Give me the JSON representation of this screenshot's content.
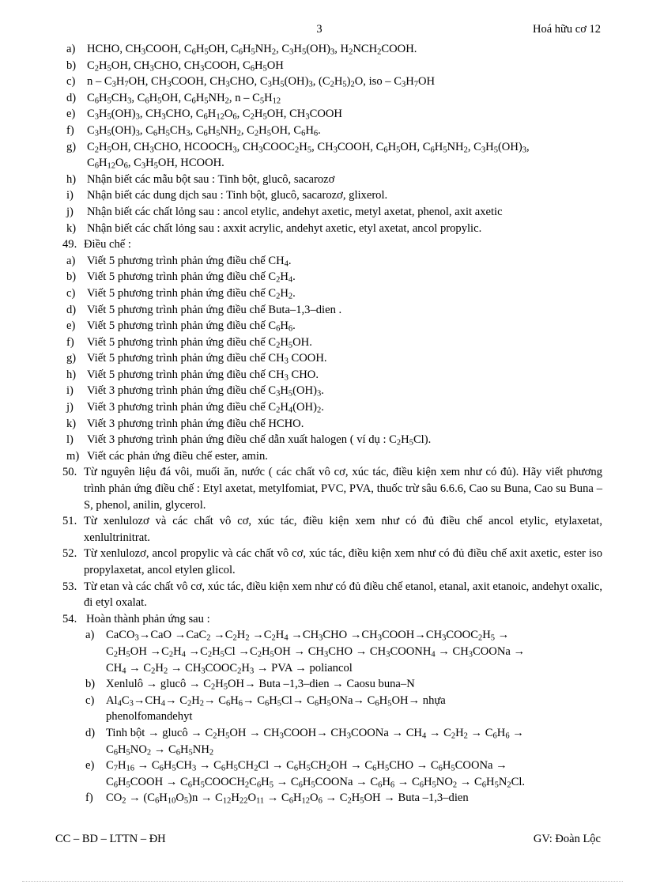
{
  "header": {
    "page_number": "3",
    "document_title": "Hoá hữu cơ 12"
  },
  "footer": {
    "left": "CC – BD – LTTN – ĐH",
    "right": "GV: Đoàn Lộc"
  },
  "exercise_48_items": [
    {
      "marker": "a)",
      "text": "HCHO, CH3COOH, C6H5OH,  C6H5NH2, C3H5(OH)3, H2NCH2COOH."
    },
    {
      "marker": "b)",
      "text": "C2H5OH, CH3CHO, CH3COOH, C6H5OH"
    },
    {
      "marker": "c)",
      "text": " n – C3H7OH, CH3COOH, CH3CHO, C3H5(OH)3, (C2H5)2O, iso – C3H7OH"
    },
    {
      "marker": "d)",
      "text": "C6H5CH3, C6H5OH,  C6H5NH2, n – C5H12"
    },
    {
      "marker": "e)",
      "text": "C3H5(OH)3, CH3CHO, C6H12O6, C2H5OH, CH3COOH"
    },
    {
      "marker": "f)",
      "text": "C3H5(OH)3, C6H5CH3, C6H5NH2, C2H5OH, C6H6."
    },
    {
      "marker": "g)",
      "line1": "C2H5OH, CH3CHO, HCOOCH3, CH3COOC2H5, CH3COOH, C6H5OH, C6H5NH2, C3H5(OH)3,",
      "line2": "C6H12O6, C3H5OH, HCOOH."
    },
    {
      "marker": "h)",
      "text": "Nhận biết các mẫu bột sau : Tinh bột, glucô, sacarozơ"
    },
    {
      "marker": "i)",
      "text": "Nhận biết các dung dịch sau : Tinh bột, glucô, sacarozơ, glixerol."
    },
    {
      "marker": "j)",
      "text": "Nhận biết các chất lỏng sau : ancol etylic, andehyt axetic, metyl axetat, phenol, axit axetic"
    },
    {
      "marker": "k)",
      "text": "Nhận biết các chất lỏng sau : axxit acrylic, andehyt axetic, etyl axetat, ancol propylic."
    }
  ],
  "exercise_49": {
    "number": "49.",
    "title": "Điều chế :",
    "items": [
      {
        "marker": "a)",
        "text": "Viết 5 phương trình phản ứng điều chế CH4."
      },
      {
        "marker": "b)",
        "text": "Viết 5 phương trình phản ứng điều chế C2H4."
      },
      {
        "marker": "c)",
        "text": "Viết 5 phương trình phản ứng điều chế C2H2."
      },
      {
        "marker": "d)",
        "text": "Viết 5 phương trình phản ứng điều chế Buta–1,3–dien ."
      },
      {
        "marker": "e)",
        "text": "Viết 5 phương trình phản ứng điều chế C6H6."
      },
      {
        "marker": "f)",
        "text": "Viết 5 phương trình phản ứng điều chế C2H5OH."
      },
      {
        "marker": "g)",
        "text": "Viết 5 phương trình phản ứng điều chế CH3 COOH."
      },
      {
        "marker": "h)",
        "text": "Viết 5 phương trình phản ứng điều chế CH3 CHO."
      },
      {
        "marker": "i)",
        "text": "Viết 3 phương trình phản ứng điều chế C3H5(OH)3."
      },
      {
        "marker": "j)",
        "text": "Viết 3 phương trình phản ứng điều chế C2H4(OH)2."
      },
      {
        "marker": "k)",
        "text": "Viết 3 phương trình phản ứng điều chế HCHO."
      },
      {
        "marker": "l)",
        "text": "Viết 3 phương trình phản ứng điều chế dẫn xuất halogen ( ví dụ : C2H5Cl)."
      },
      {
        "marker": "m)",
        "text": "Viết các phản ứng điều chế ester, amin."
      }
    ]
  },
  "exercise_50": {
    "number": "50.",
    "text": "Từ nguyên liệu đá vôi, muối ăn, nước ( các chất vô cơ, xúc tác, điều kiện xem như có đủ). Hãy viết phương trình phản ứng điều chế : Etyl axetat, metylfomiat, PVC, PVA, thuốc trừ sâu 6.6.6, Cao su Buna, Cao su Buna – S, phenol, anilin, glycerol."
  },
  "exercise_51": {
    "number": "51.",
    "text": "Từ xenlulozơ và các chất vô cơ, xúc tác, điều kiện xem như có đủ điều chế ancol etylic, etylaxetat, xenlultrinitrat."
  },
  "exercise_52": {
    "number": "52.",
    "text": "Từ xenlulozơ, ancol propylic và các chất vô cơ, xúc tác, điều kiện xem như có đủ điều chế axit axetic, ester iso propylaxetat, ancol etylen glicol."
  },
  "exercise_53": {
    "number": "53.",
    "text": "Từ etan và các chất vô cơ, xúc tác, điều kiện xem như có đủ điều chế etanol, etanal, axit etanoic, andehyt oxalic, đi etyl oxalat."
  },
  "exercise_54": {
    "number": "54.",
    "title": "Hoàn thành phản ứng sau :",
    "items": [
      {
        "marker": "a)",
        "line1": "CaCO3→CaO  →CaC2  →C2H2  →C2H4  →CH3CHO   →CH3COOH→CH3COOC2H5  →",
        "line2": "C2H5OH →C2H4 →C2H5Cl →C2H5OH → CH3CHO → CH3COONH4 → CH3COONa →",
        "line3": "CH4 → C2H2 → CH3COOC2H3 → PVA → poliancol"
      },
      {
        "marker": "b)",
        "line1": "Xenlulô → glucô → C2H5OH→ Buta –1,3–dien → Caosu buna–N"
      },
      {
        "marker": "c)",
        "line1": "Al4C3→CH4→    C2H2→    C6H6→    C6H5Cl→    C6H5ONa→    C6H5OH→    nhựa",
        "line2": "phenolfomandehyt"
      },
      {
        "marker": "d)",
        "line1": "Tinh bột → glucô → C2H5OH → CH3COOH→ CH3COONa →  CH4 → C2H2 → C6H6  →",
        "line2": "C6H5NO2 → C6H5NH2"
      },
      {
        "marker": "e)",
        "line1": "C7H16  →  C6H5CH3  →  C6H5CH2Cl  →  C6H5CH2OH  →  C6H5CHO  →  C6H5COONa  →",
        "line2": "C6H5COOH → C6H5COOCH2C6H5 → C6H5COONa → C6H6 →  C6H5NO2 → C6H5N2Cl."
      },
      {
        "marker": "f)",
        "line1": "CO2 → (C6H10O5)n → C12H22O11 → C6H12O6 → C2H5OH → Buta –1,3–dien"
      }
    ]
  }
}
